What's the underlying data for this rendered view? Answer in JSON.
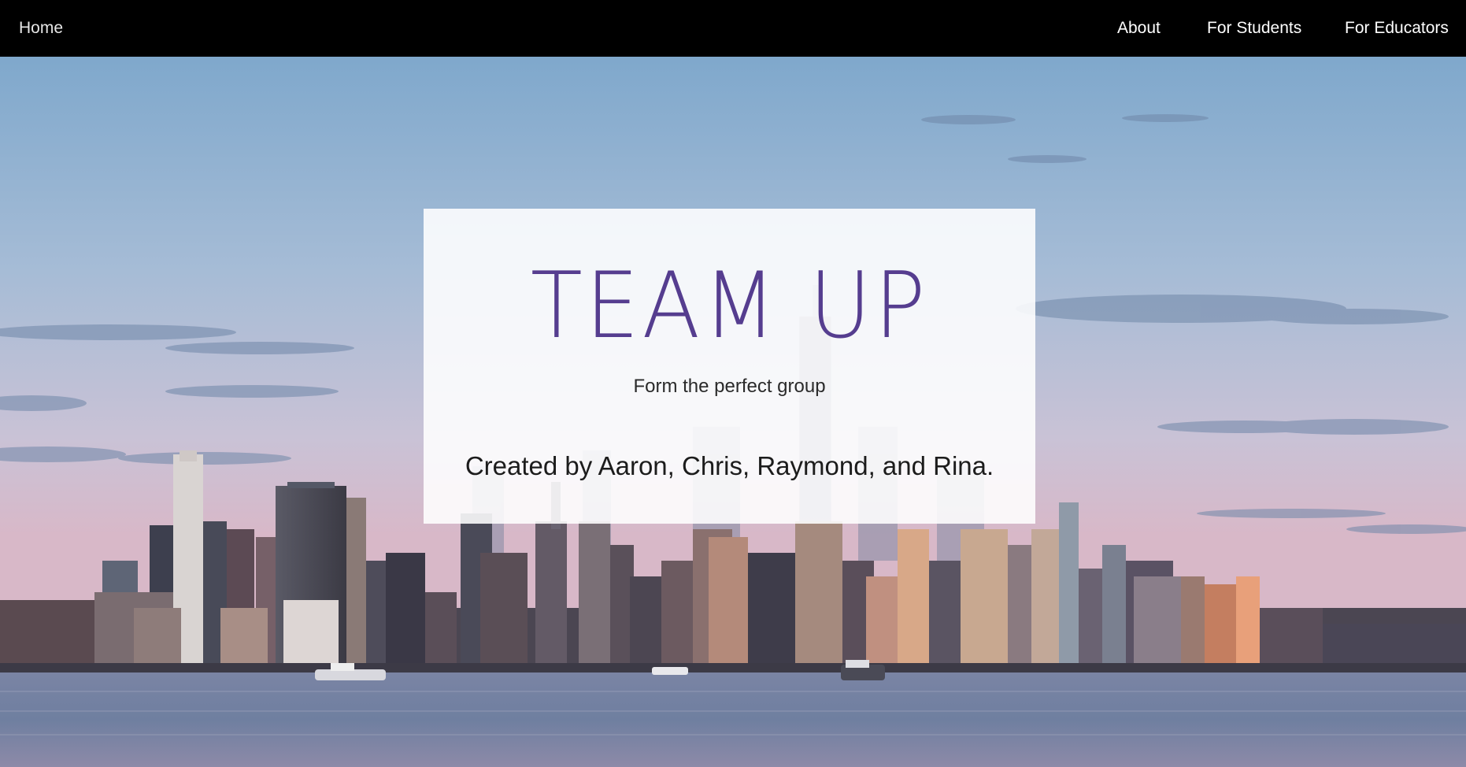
{
  "nav": {
    "home": "Home",
    "about": "About",
    "for_students": "For Students",
    "for_educators": "For Educators"
  },
  "hero": {
    "title": "TEAM UP",
    "tagline": "Form the perfect group",
    "credits": "Created by Aaron, Chris, Raymond, and Rina."
  },
  "colors": {
    "navbar_bg": "#000000",
    "nav_text": "#ffffff",
    "title_purple": "#553d8f",
    "card_bg": "rgba(255,255,255,0.88)",
    "sky_top": "#7fa8cc",
    "sky_bottom": "#d8b8c8",
    "water": "#6f7fa0"
  },
  "background": {
    "icon": "city-skyline-photo"
  }
}
